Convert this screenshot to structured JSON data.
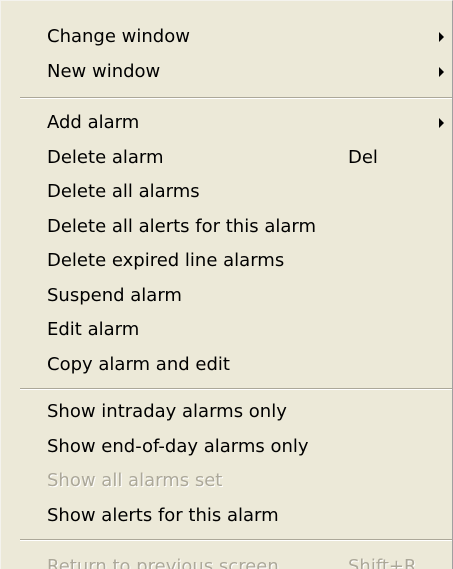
{
  "menu": {
    "items": [
      {
        "label": "Change window",
        "submenu": true
      },
      {
        "label": "New window",
        "submenu": true
      },
      {
        "label": "Add alarm",
        "submenu": true
      },
      {
        "label": "Delete alarm",
        "shortcut": "Del"
      },
      {
        "label": "Delete all alarms"
      },
      {
        "label": "Delete all alerts for this alarm"
      },
      {
        "label": "Delete expired line alarms"
      },
      {
        "label": "Suspend alarm"
      },
      {
        "label": "Edit alarm"
      },
      {
        "label": "Copy alarm and edit"
      },
      {
        "label": "Show intraday alarms only"
      },
      {
        "label": "Show end-of-day alarms only"
      },
      {
        "label": "Show all alarms set",
        "disabled": true
      },
      {
        "label": "Show alerts for this alarm"
      },
      {
        "label": "Return to previous screen",
        "shortcut": "Shift+R",
        "disabled": true
      }
    ]
  },
  "colors": {
    "menu_background": "#ece9d8",
    "disabled_text": "#aca899",
    "separator": "#aca899"
  },
  "icons": {
    "submenu_arrow": "submenu-arrow-icon"
  }
}
